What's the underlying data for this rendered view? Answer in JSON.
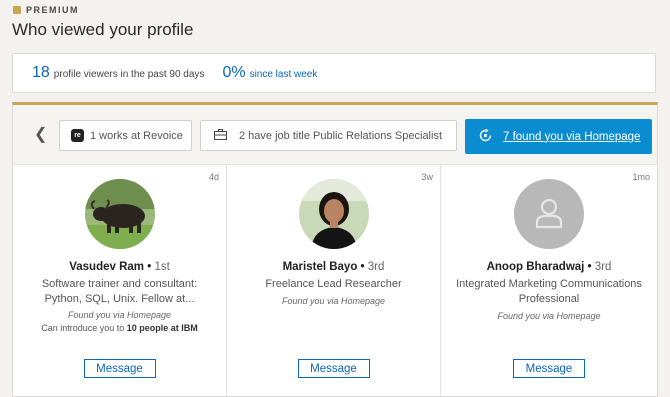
{
  "premium": {
    "label": "PREMIUM"
  },
  "page": {
    "title": "Who viewed your profile"
  },
  "stats": {
    "viewers_count": "18",
    "viewers_text": "profile viewers in the past 90 days",
    "change_percent": "0%",
    "change_text": "since last week"
  },
  "filters": [
    {
      "label": "1 works at Revoice",
      "icon": "revoice-logo",
      "logo_text": "re"
    },
    {
      "label": "2 have job title Public Relations Specialist",
      "icon": "briefcase-icon"
    },
    {
      "label": "7 found you via Homepage",
      "icon": "refresh-icon",
      "active": true
    }
  ],
  "viewers": [
    {
      "name": "Vasudev Ram",
      "degree": "1st",
      "headline": "Software trainer and consultant: Python, SQL, Unix. Fellow at...",
      "found_via": "Found you via Homepage",
      "intro_prefix": "Can introduce you to",
      "intro_bold": "10 people at IBM",
      "time_ago": "4d",
      "button": "Message"
    },
    {
      "name": "Maristel Bayo",
      "degree": "3rd",
      "headline": "Freelance Lead Researcher",
      "found_via": "Found you via Homepage",
      "time_ago": "3w",
      "button": "Message"
    },
    {
      "name": "Anoop Bharadwaj",
      "degree": "3rd",
      "headline": "Integrated Marketing Communications Professional",
      "found_via": "Found you via Homepage",
      "time_ago": "1mo",
      "button": "Message"
    }
  ],
  "colors": {
    "accent": "#0a66c2",
    "premium_gold": "#c7a658",
    "active_chip": "#0a8cd1"
  }
}
